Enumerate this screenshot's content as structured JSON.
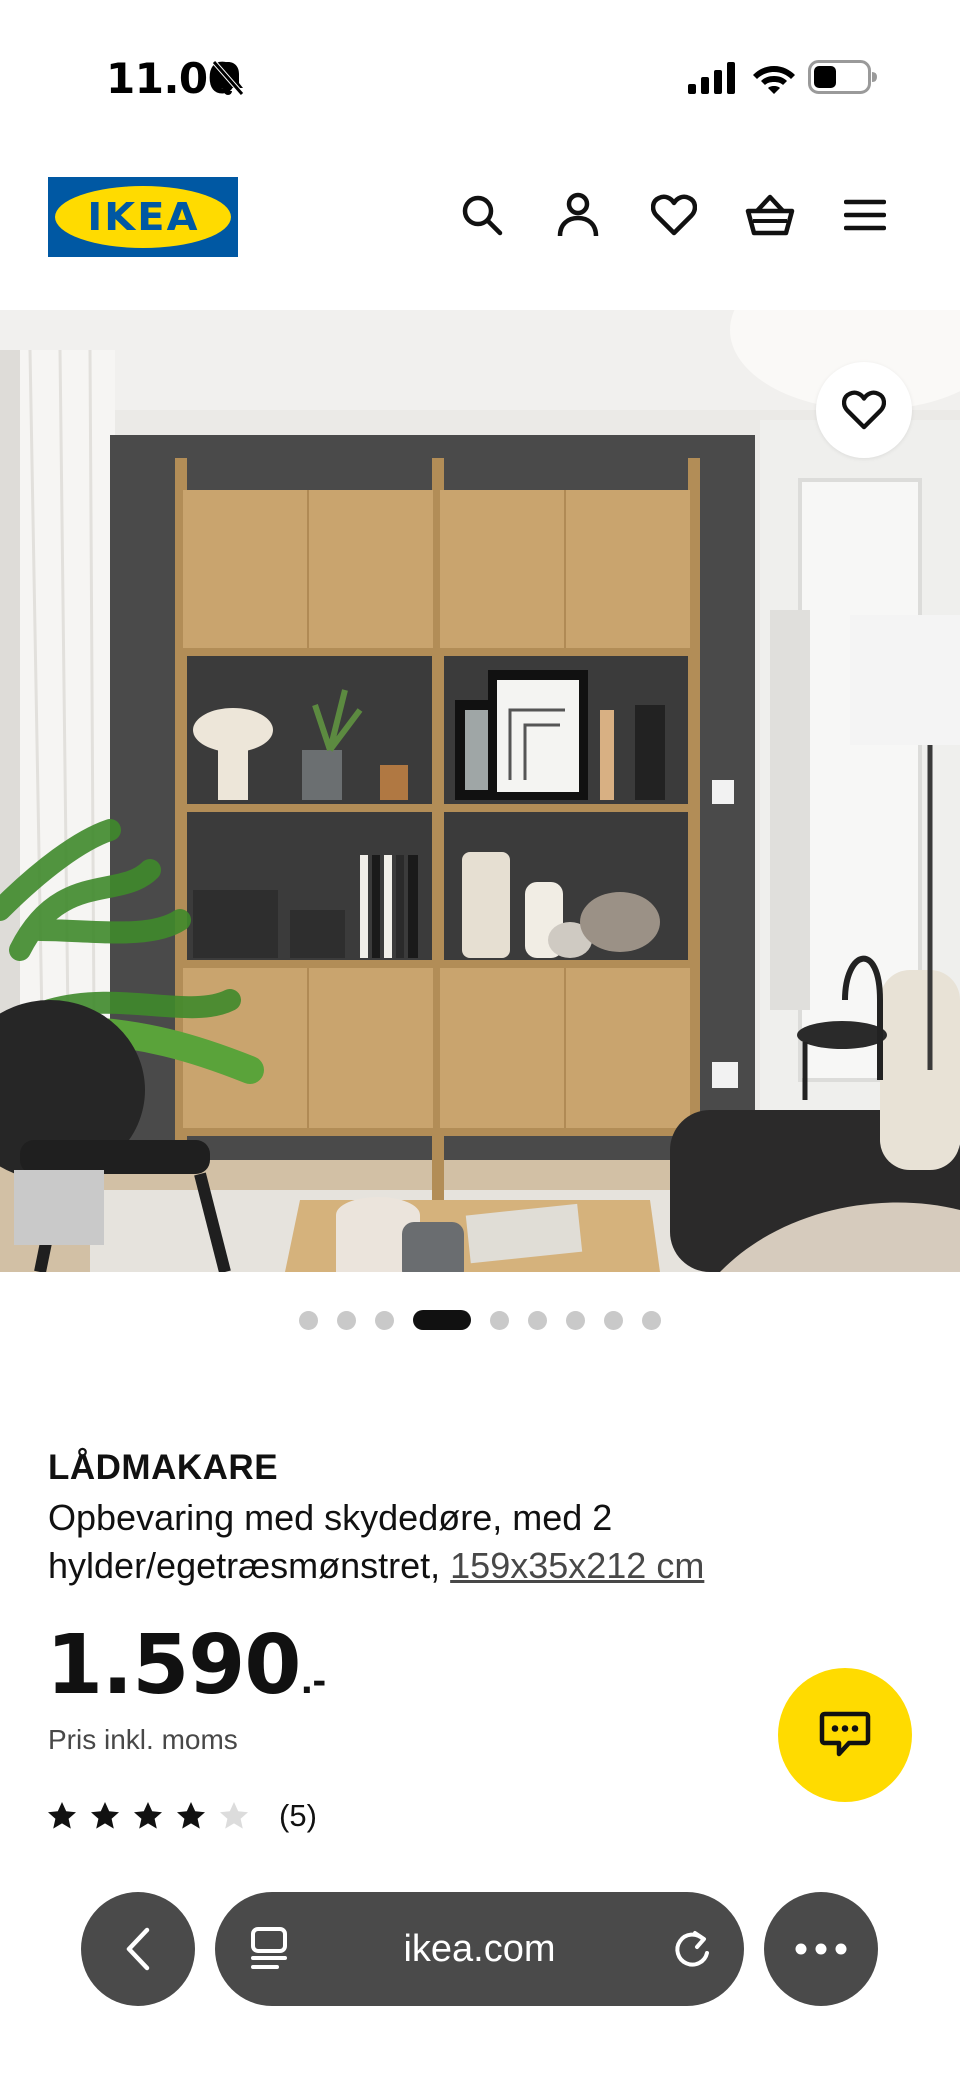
{
  "status_bar": {
    "time": "11.00",
    "icons": [
      "bell-slash-icon",
      "cellular-signal-icon",
      "wifi-icon",
      "battery-icon"
    ]
  },
  "header": {
    "logo_text": "IKEA",
    "icons": [
      "search-icon",
      "account-icon",
      "heart-icon",
      "basket-icon",
      "menu-icon"
    ]
  },
  "gallery": {
    "image_alt": "LÅDMAKARE storage with sliding doors in a living room",
    "favorite_icon": "heart-icon",
    "dot_count": 9,
    "active_index": 3
  },
  "product": {
    "name": "LÅDMAKARE",
    "description": "Opbevaring med skydedøre, med 2 hylder/egetræsmønstret,",
    "measurements": "159x35x212 cm",
    "price": "1.590",
    "price_suffix": ".-",
    "price_note": "Pris inkl. moms",
    "rating": 4,
    "rating_max": 5,
    "rating_count": "(5)"
  },
  "chat": {
    "icon": "chat-icon"
  },
  "browser": {
    "url": "ikea.com",
    "icons": [
      "back-icon",
      "reader-icon",
      "reload-icon",
      "more-icon"
    ]
  },
  "colors": {
    "ikea_blue": "#0058a3",
    "ikea_yellow": "#ffdb00",
    "browser_pill": "#4a4a4a",
    "dot_inactive": "#c9c9c9",
    "dot_active": "#111111"
  }
}
